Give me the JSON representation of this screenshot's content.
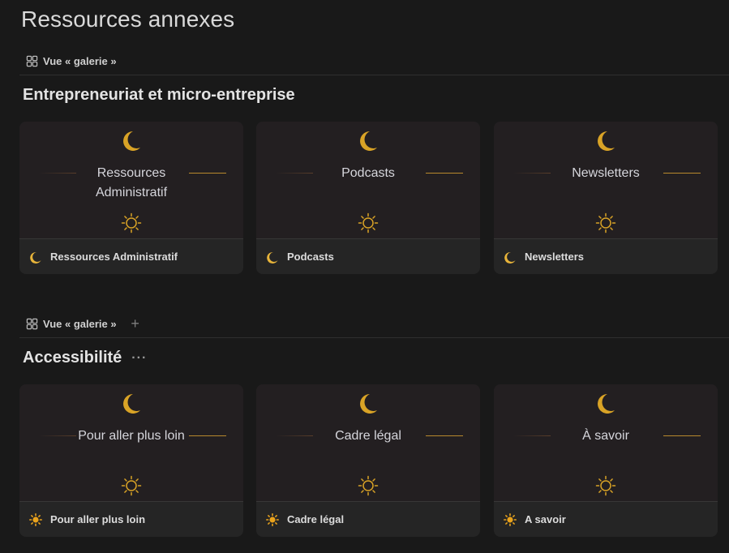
{
  "page": {
    "title": "Ressources annexes"
  },
  "views": [
    {
      "label": "Vue « galerie »",
      "icon": "gallery-icon",
      "has_add": false
    },
    {
      "label": "Vue « galerie »",
      "icon": "gallery-icon",
      "has_add": true,
      "add_label": "+"
    }
  ],
  "sections": [
    {
      "title": "Entrepreneuriat et micro-entreprise",
      "cards": [
        {
          "cover_text": "Ressources Administratif",
          "footer_title": "Ressources Administratif",
          "footer_icon": "crescent-moon-icon"
        },
        {
          "cover_text": "Podcasts",
          "footer_title": "Podcasts",
          "footer_icon": "crescent-moon-icon"
        },
        {
          "cover_text": "Newsletters",
          "footer_title": "Newsletters",
          "footer_icon": "crescent-moon-icon"
        }
      ]
    },
    {
      "title": "Accessibilité",
      "more_label": "···",
      "cards": [
        {
          "cover_text": "Pour aller plus loin",
          "footer_title": "Pour aller plus loin",
          "footer_icon": "sun-icon"
        },
        {
          "cover_text": "Cadre légal",
          "footer_title": "Cadre légal",
          "footer_icon": "sun-icon"
        },
        {
          "cover_text": "À savoir",
          "footer_title": "A savoir",
          "footer_icon": "sun-icon"
        }
      ]
    }
  ],
  "colors": {
    "background": "#191919",
    "card": "#252525",
    "cover": "#231f21",
    "accent_gold": "#d9a326",
    "sun_orange": "#e8a21c"
  }
}
